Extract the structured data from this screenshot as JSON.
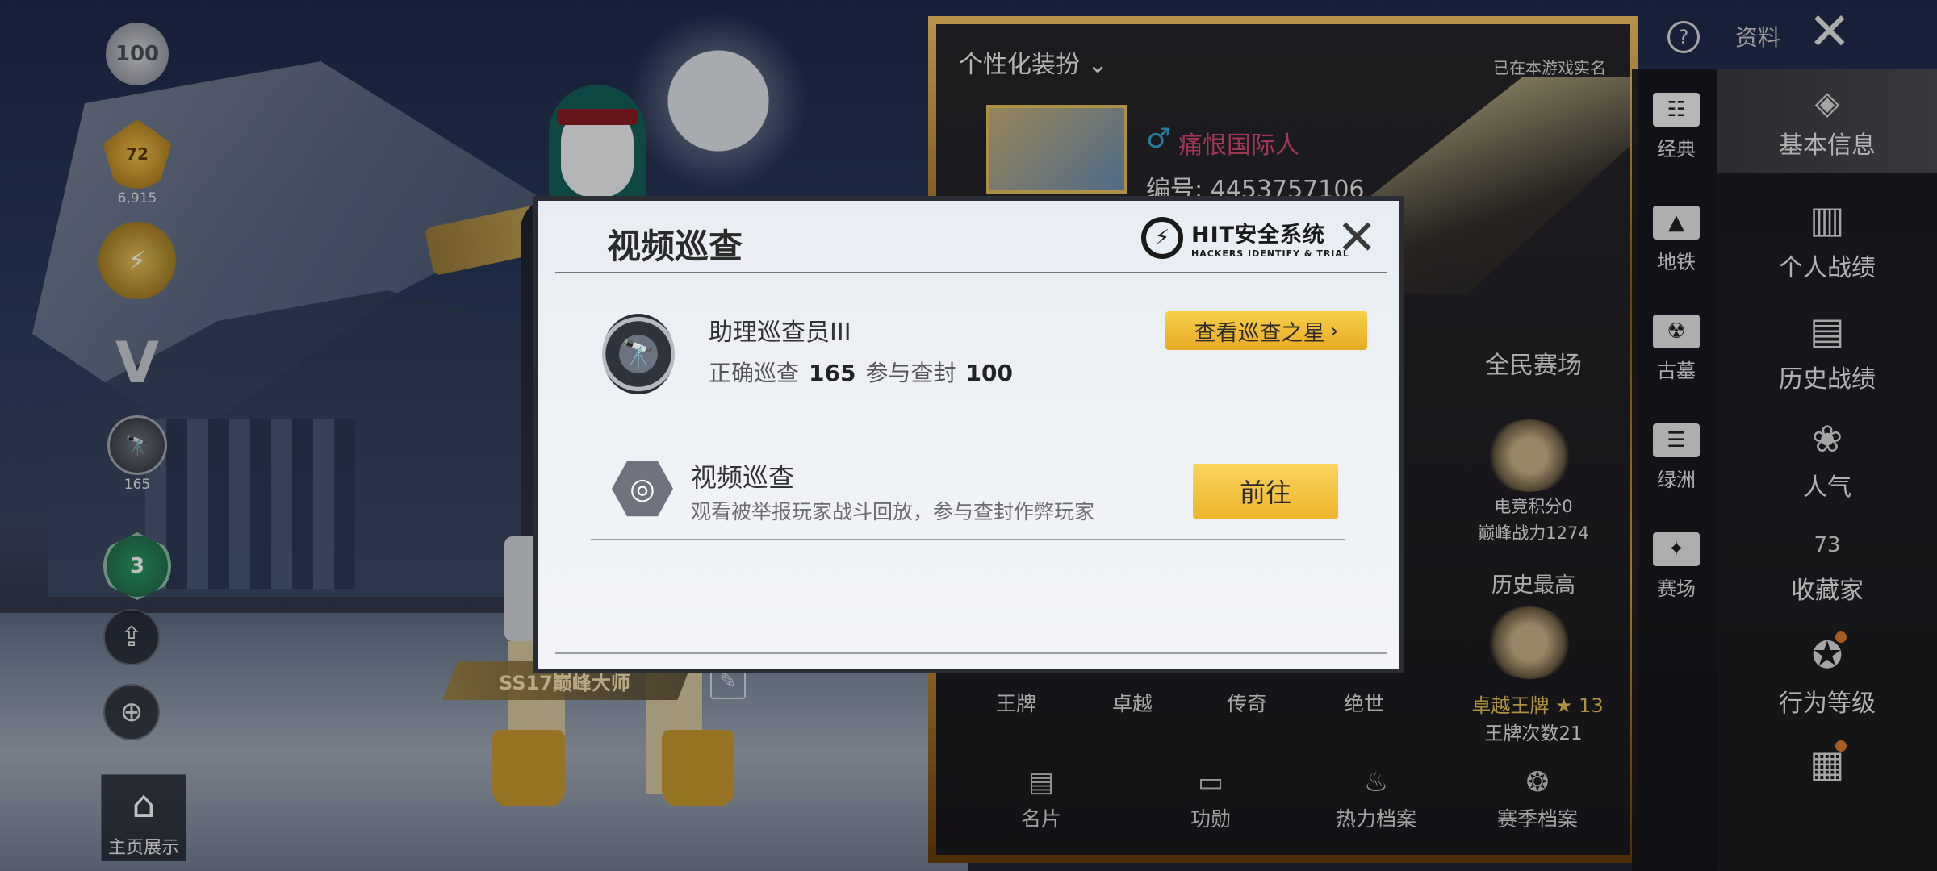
{
  "left_column": {
    "badge_100": "100",
    "badge_level": "72",
    "badge_points": "6,915",
    "badge_patrol_count": "165",
    "rank_badge": "3",
    "home_label": "主页展示"
  },
  "title_plate": "SS17巅峰大师",
  "profile": {
    "personalize": "个性化装扮",
    "verified": "已在本游戏实名",
    "name": "痛恨国际人",
    "gender_icon": "male-icon",
    "id_label": "编号: 4453757106",
    "section_all": "全民赛场",
    "esports_points": "电竞积分0",
    "peak_power": "巅峰战力1274",
    "history_best": "历史最高",
    "best_rank": "卓越王牌",
    "best_rank_stars": "13",
    "ace_count": "王牌次数21",
    "tiers": [
      "王牌",
      "卓越",
      "传奇",
      "绝世"
    ],
    "bottom_tabs": [
      "名片",
      "功勋",
      "热力档案",
      "赛季档案"
    ]
  },
  "nav_modes": [
    {
      "label": "经典",
      "icon": "classic-icon"
    },
    {
      "label": "地铁",
      "icon": "metro-icon"
    },
    {
      "label": "古墓",
      "icon": "tomb-icon"
    },
    {
      "label": "绿洲",
      "icon": "oasis-icon"
    },
    {
      "label": "赛场",
      "icon": "arena-icon"
    }
  ],
  "nav_sections": [
    {
      "label": "基本信息",
      "icon": "basic-info-icon"
    },
    {
      "label": "个人战绩",
      "icon": "personal-stats-icon"
    },
    {
      "label": "历史战绩",
      "icon": "history-stats-icon"
    },
    {
      "label": "人气",
      "icon": "popularity-icon"
    },
    {
      "label": "收藏家",
      "icon": "collector-icon",
      "badge": "73"
    },
    {
      "label": "行为等级",
      "icon": "behavior-level-icon"
    },
    {
      "label": "",
      "icon": "document-icon"
    }
  ],
  "top_right": {
    "data_label": "资料"
  },
  "modal": {
    "title": "视频巡查",
    "logo_title": "HIT安全系统",
    "logo_sub": "HACKERS IDENTIFY & TRIAL",
    "inspector_title": "助理巡查员III",
    "correct_label": "正确巡查",
    "correct_value": "165",
    "ban_label": "参与查封",
    "ban_value": "100",
    "star_button": "查看巡查之星",
    "video_title": "视频巡查",
    "video_desc": "观看被举报玩家战斗回放，参与查封作弊玩家",
    "go_button": "前往"
  }
}
